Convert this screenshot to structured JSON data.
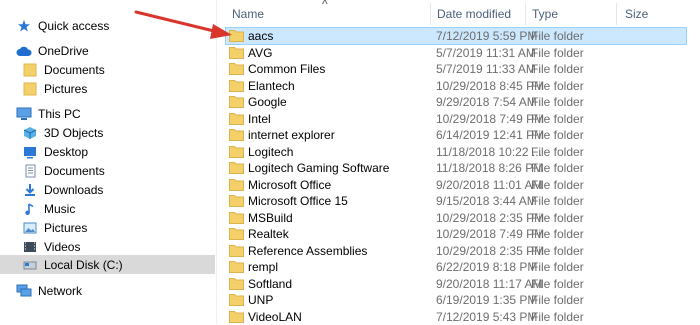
{
  "colors": {
    "selection": "#cce8ff",
    "selection_border": "#99d1ff",
    "nav_selected": "#d9d9d9",
    "header_text": "#4c607a",
    "folder": "#f3d06a",
    "arrow": "#d9352c"
  },
  "nav": {
    "items": [
      {
        "label": "Quick access",
        "icon": "star-icon"
      },
      {
        "label": "OneDrive",
        "icon": "cloud-icon"
      },
      {
        "label": "Documents",
        "icon": "folder-icon"
      },
      {
        "label": "Pictures",
        "icon": "folder-icon"
      },
      {
        "label": "This PC",
        "icon": "computer-icon"
      },
      {
        "label": "3D Objects",
        "icon": "cube-icon"
      },
      {
        "label": "Desktop",
        "icon": "desktop-icon"
      },
      {
        "label": "Documents",
        "icon": "document-icon"
      },
      {
        "label": "Downloads",
        "icon": "download-icon"
      },
      {
        "label": "Music",
        "icon": "music-icon"
      },
      {
        "label": "Pictures",
        "icon": "pictures-icon"
      },
      {
        "label": "Videos",
        "icon": "video-icon"
      },
      {
        "label": "Local Disk (C:)",
        "icon": "drive-icon"
      },
      {
        "label": "Network",
        "icon": "network-icon"
      }
    ]
  },
  "columns": {
    "name": "Name",
    "date": "Date modified",
    "type": "Type",
    "size": "Size"
  },
  "files": [
    {
      "name": "aacs",
      "date": "7/12/2019 5:59 PM",
      "type": "File folder"
    },
    {
      "name": "AVG",
      "date": "5/7/2019 11:31 AM",
      "type": "File folder"
    },
    {
      "name": "Common Files",
      "date": "5/7/2019 11:33 AM",
      "type": "File folder"
    },
    {
      "name": "Elantech",
      "date": "10/29/2018 8:45 PM",
      "type": "File folder"
    },
    {
      "name": "Google",
      "date": "9/29/2018 7:54 AM",
      "type": "File folder"
    },
    {
      "name": "Intel",
      "date": "10/29/2018 7:49 PM",
      "type": "File folder"
    },
    {
      "name": "internet explorer",
      "date": "6/14/2019 12:41 PM",
      "type": "File folder"
    },
    {
      "name": "Logitech",
      "date": "11/18/2018 10:22 ...",
      "type": "File folder"
    },
    {
      "name": "Logitech Gaming Software",
      "date": "11/18/2018 8:26 PM",
      "type": "File folder"
    },
    {
      "name": "Microsoft Office",
      "date": "9/20/2018 11:01 AM",
      "type": "File folder"
    },
    {
      "name": "Microsoft Office 15",
      "date": "9/15/2018 3:44 AM",
      "type": "File folder"
    },
    {
      "name": "MSBuild",
      "date": "10/29/2018 2:35 PM",
      "type": "File folder"
    },
    {
      "name": "Realtek",
      "date": "10/29/2018 7:49 PM",
      "type": "File folder"
    },
    {
      "name": "Reference Assemblies",
      "date": "10/29/2018 2:35 PM",
      "type": "File folder"
    },
    {
      "name": "rempl",
      "date": "6/22/2019 8:18 PM",
      "type": "File folder"
    },
    {
      "name": "Softland",
      "date": "9/20/2018 11:17 AM",
      "type": "File folder"
    },
    {
      "name": "UNP",
      "date": "6/19/2019 1:35 PM",
      "type": "File folder"
    },
    {
      "name": "VideoLAN",
      "date": "7/12/2019 5:43 PM",
      "type": "File folder"
    }
  ]
}
